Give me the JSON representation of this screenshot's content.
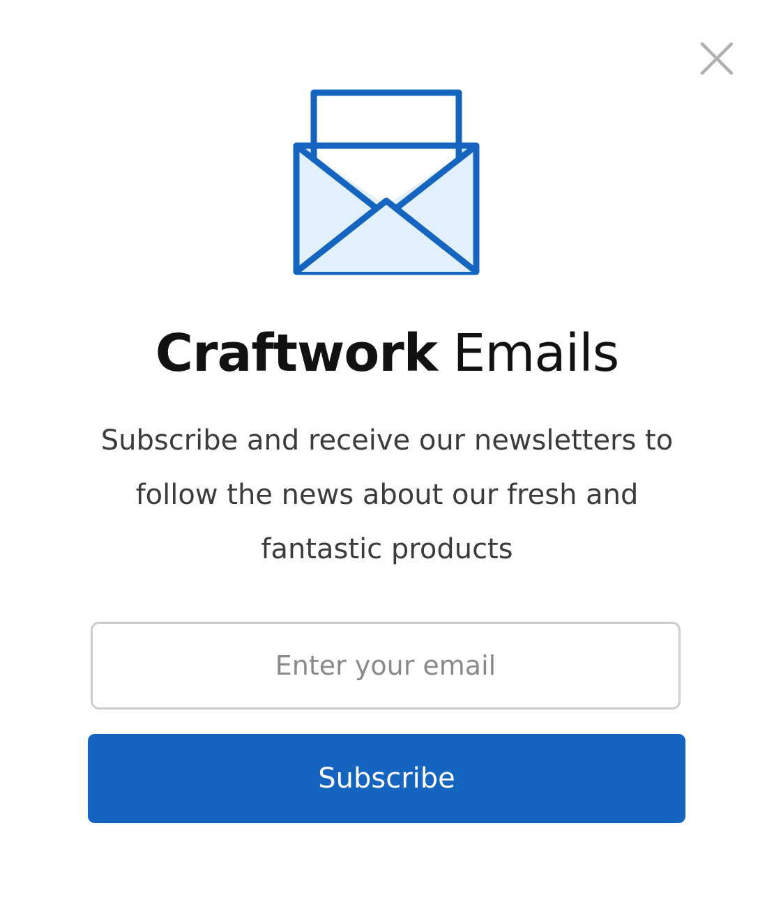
{
  "modal": {
    "close_icon": "close-icon",
    "envelope_icon": "envelope-open-icon",
    "title": {
      "bold": "Craftwork",
      "light": "Emails"
    },
    "description": "Subscribe and receive our newsletters to follow the news about our fresh and fantastic products",
    "email_input": {
      "value": "",
      "placeholder": "Enter your email"
    },
    "subscribe_button": {
      "label": "Subscribe"
    }
  },
  "colors": {
    "accent": "#1565c0",
    "envelope_fill": "#e1f0fa",
    "close_icon": "#b0b0b0",
    "title": "#111111",
    "text": "#3b3b3b",
    "input_border": "#cccccc",
    "placeholder": "#8a8a8a"
  }
}
